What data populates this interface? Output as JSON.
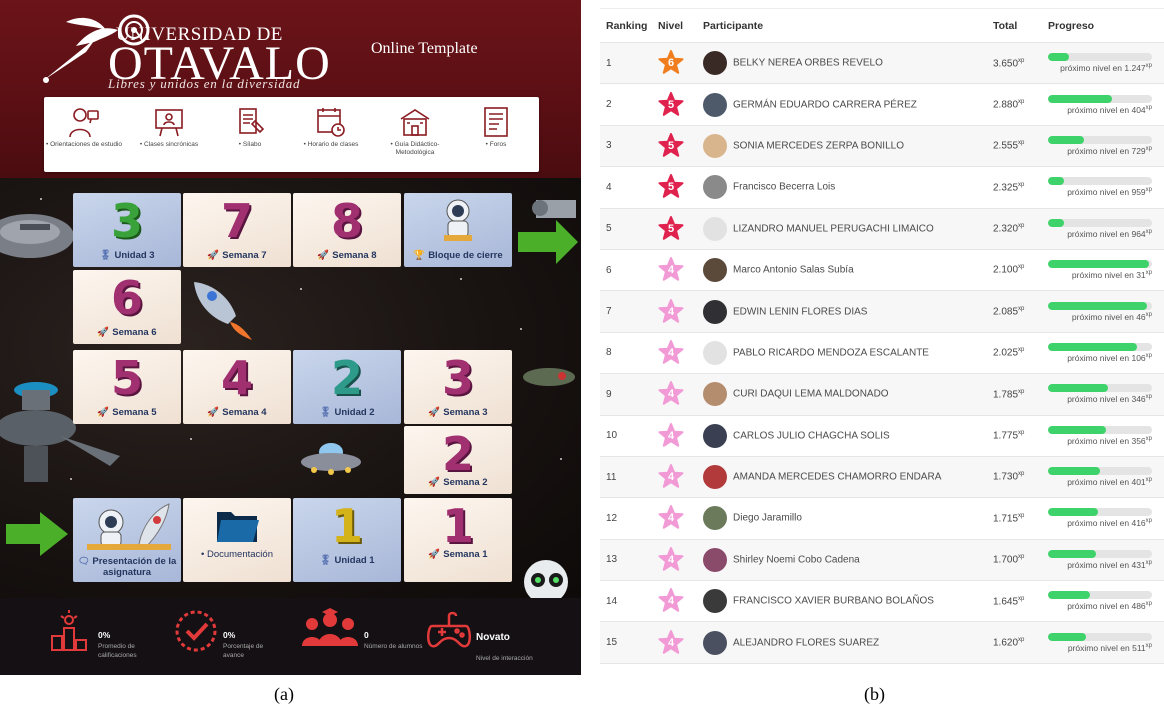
{
  "panel_a": {
    "logo": {
      "line1": "UNIVERSIDAD DE",
      "line2": "OTAVALO",
      "slogan": "Libres y unidos en la diversidad"
    },
    "header_title": "Online Template",
    "nav_items": [
      {
        "label": "• Orientaciones de estudio",
        "icon": "advisor-icon"
      },
      {
        "label": "• Clases sincrónicas",
        "icon": "presentation-board-icon"
      },
      {
        "label": "• Sílabo",
        "icon": "syllabus-icon"
      },
      {
        "label": "• Horario de clases",
        "icon": "calendar-clock-icon"
      },
      {
        "label": "• Guía Didáctico-Metodológica",
        "icon": "school-building-icon"
      },
      {
        "label": "• Foros",
        "icon": "forum-icon"
      }
    ],
    "tiles": [
      {
        "id": "unidad-3",
        "num": "3",
        "label": "Unidad 3",
        "icon": "medal-icon"
      },
      {
        "id": "semana-7",
        "num": "7",
        "label": "Semana 7",
        "icon": "rocket-icon"
      },
      {
        "id": "semana-8",
        "num": "8",
        "label": "Semana 8",
        "icon": "rocket-icon"
      },
      {
        "id": "bloque-cierre",
        "num": "",
        "label": "Bloque de cierre",
        "icon": "trophy-icon"
      },
      {
        "id": "semana-6",
        "num": "6",
        "label": "Semana 6",
        "icon": "rocket-icon"
      },
      {
        "id": "semana-5",
        "num": "5",
        "label": "Semana 5",
        "icon": "rocket-icon"
      },
      {
        "id": "semana-4",
        "num": "4",
        "label": "Semana 4",
        "icon": "rocket-icon"
      },
      {
        "id": "unidad-2",
        "num": "2",
        "label": "Unidad 2",
        "icon": "medal-icon"
      },
      {
        "id": "semana-3",
        "num": "3",
        "label": "Semana 3",
        "icon": "rocket-icon"
      },
      {
        "id": "semana-2",
        "num": "2",
        "label": "Semana 2",
        "icon": "rocket-icon"
      },
      {
        "id": "presentacion",
        "num": "",
        "label": "Presentación de la asignatura",
        "icon": "chat-icon"
      },
      {
        "id": "documentacion",
        "num": "",
        "label": "• Documentación",
        "icon": "folder-icon"
      },
      {
        "id": "unidad-1",
        "num": "1",
        "label": "Unidad 1",
        "icon": "medal-icon"
      },
      {
        "id": "semana-1",
        "num": "1",
        "label": "Semana 1",
        "icon": "rocket-icon"
      }
    ],
    "stats": [
      {
        "value": "0%",
        "desc": "Promedio de calificaciones",
        "icon": "podium-icon"
      },
      {
        "value": "0%",
        "desc": "Porcentaje de avance",
        "icon": "progress-check-icon"
      },
      {
        "value": "0",
        "desc": "Número de alumnos",
        "icon": "students-icon"
      },
      {
        "value": "Novato",
        "desc": "Nivel de interacción",
        "icon": "gamepad-icon"
      }
    ],
    "caption": "(a)"
  },
  "panel_b": {
    "columns": [
      "Ranking",
      "Nivel",
      "Participante",
      "Total",
      "Progreso"
    ],
    "xp_unit": "xp",
    "progress_prefix": "próximo nivel en",
    "rows": [
      {
        "rank": "1",
        "level": "6",
        "level_color": "#f07d1e",
        "name": "BELKY NEREA ORBES REVELO",
        "total": "3.650",
        "next": "1.247",
        "progress": 0.2,
        "avatar_color": "#3a2a26"
      },
      {
        "rank": "2",
        "level": "5",
        "level_color": "#e0224e",
        "name": "GERMÁN EDUARDO CARRERA PÉREZ",
        "total": "2.880",
        "next": "404",
        "progress": 0.62,
        "avatar_color": "#4e5a6a"
      },
      {
        "rank": "3",
        "level": "5",
        "level_color": "#e0224e",
        "name": "SONIA MERCEDES ZERPA BONILLO",
        "total": "2.555",
        "next": "729",
        "progress": 0.35,
        "avatar_color": "#d9b58e"
      },
      {
        "rank": "4",
        "level": "5",
        "level_color": "#e0224e",
        "name": "Francisco Becerra Lois",
        "total": "2.325",
        "next": "959",
        "progress": 0.15,
        "avatar_color": "#8a8a8a"
      },
      {
        "rank": "5",
        "level": "5",
        "level_color": "#e0224e",
        "name": "LIZANDRO MANUEL PERUGACHI LIMAICO",
        "total": "2.320",
        "next": "964",
        "progress": 0.15,
        "avatar_color": "#e2e2e2"
      },
      {
        "rank": "6",
        "level": "4",
        "level_color": "#f29ad6",
        "name": "Marco Antonio Salas Subía",
        "total": "2.100",
        "next": "31",
        "progress": 0.97,
        "avatar_color": "#5b4a3a"
      },
      {
        "rank": "7",
        "level": "4",
        "level_color": "#f29ad6",
        "name": "EDWIN LENIN FLORES DIAS",
        "total": "2.085",
        "next": "46",
        "progress": 0.95,
        "avatar_color": "#2f2f34"
      },
      {
        "rank": "8",
        "level": "4",
        "level_color": "#f29ad6",
        "name": "PABLO RICARDO MENDOZA ESCALANTE",
        "total": "2.025",
        "next": "106",
        "progress": 0.86,
        "avatar_color": "#e2e2e2"
      },
      {
        "rank": "9",
        "level": "4",
        "level_color": "#f29ad6",
        "name": "CURI DAQUI LEMA MALDONADO",
        "total": "1.785",
        "next": "346",
        "progress": 0.58,
        "avatar_color": "#b48c6e"
      },
      {
        "rank": "10",
        "level": "4",
        "level_color": "#f29ad6",
        "name": "CARLOS JULIO CHAGCHA SOLIS",
        "total": "1.775",
        "next": "356",
        "progress": 0.56,
        "avatar_color": "#3b3f52"
      },
      {
        "rank": "11",
        "level": "4",
        "level_color": "#f29ad6",
        "name": "AMANDA MERCEDES CHAMORRO ENDARA",
        "total": "1.730",
        "next": "401",
        "progress": 0.5,
        "avatar_color": "#b23a3a"
      },
      {
        "rank": "12",
        "level": "4",
        "level_color": "#f29ad6",
        "name": "Diego Jaramillo",
        "total": "1.715",
        "next": "416",
        "progress": 0.48,
        "avatar_color": "#6a7a5a"
      },
      {
        "rank": "13",
        "level": "4",
        "level_color": "#f29ad6",
        "name": "Shirley Noemi Cobo Cadena",
        "total": "1.700",
        "next": "431",
        "progress": 0.46,
        "avatar_color": "#8a4a6a"
      },
      {
        "rank": "14",
        "level": "4",
        "level_color": "#f29ad6",
        "name": "FRANCISCO XAVIER BURBANO BOLAÑOS",
        "total": "1.645",
        "next": "486",
        "progress": 0.4,
        "avatar_color": "#3a3a3a"
      },
      {
        "rank": "15",
        "level": "4",
        "level_color": "#f29ad6",
        "name": "ALEJANDRO FLORES SUAREZ",
        "total": "1.620",
        "next": "511",
        "progress": 0.37,
        "avatar_color": "#4a5060"
      }
    ],
    "caption": "(b)"
  },
  "colors": {
    "accent_red": "#5a0f14",
    "progress_green": "#3ed36a",
    "arrow_green": "#4caf2a"
  }
}
